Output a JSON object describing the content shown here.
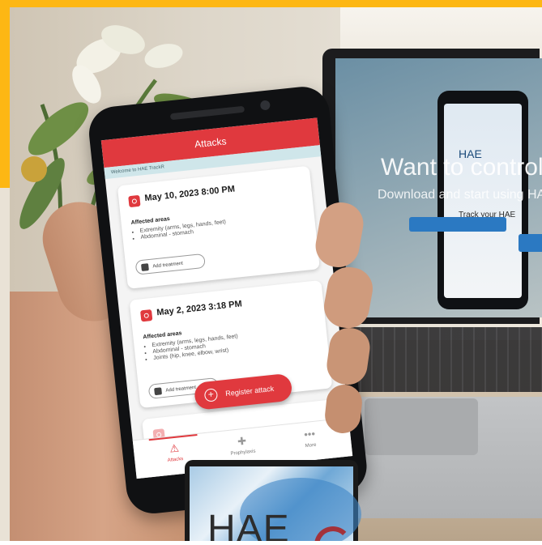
{
  "frame": {
    "accent": "#fdb714"
  },
  "laptop": {
    "headline": "Want to control y",
    "subline": "Download and start using HAE",
    "phone_brand": "HAE",
    "phone_tagline": "Track your HAE"
  },
  "app": {
    "header_title": "Attacks",
    "welcome": "Welcome to HAE TrackR",
    "accent": "#e0393e",
    "areas_label": "Affected areas",
    "treatment_label": "Add treatment",
    "attacks": [
      {
        "datetime": "May 10, 2023 8:00 PM",
        "areas": [
          "Extremity (arms, legs, hands, feet)",
          "Abdominal - stomach"
        ]
      },
      {
        "datetime": "May 2, 2023 3:18 PM",
        "areas": [
          "Extremity (arms, legs, hands, feet)",
          "Abdominal - stomach",
          "Joints (hip, knee, elbow, wrist)"
        ]
      }
    ],
    "register_button": "Register attack",
    "nav": [
      {
        "label": "Attacks",
        "icon": "warning-icon"
      },
      {
        "label": "Prophylaxis",
        "icon": "cross-icon"
      },
      {
        "label": "More",
        "icon": "more-icon"
      }
    ]
  },
  "logo": {
    "text": "HAE"
  }
}
